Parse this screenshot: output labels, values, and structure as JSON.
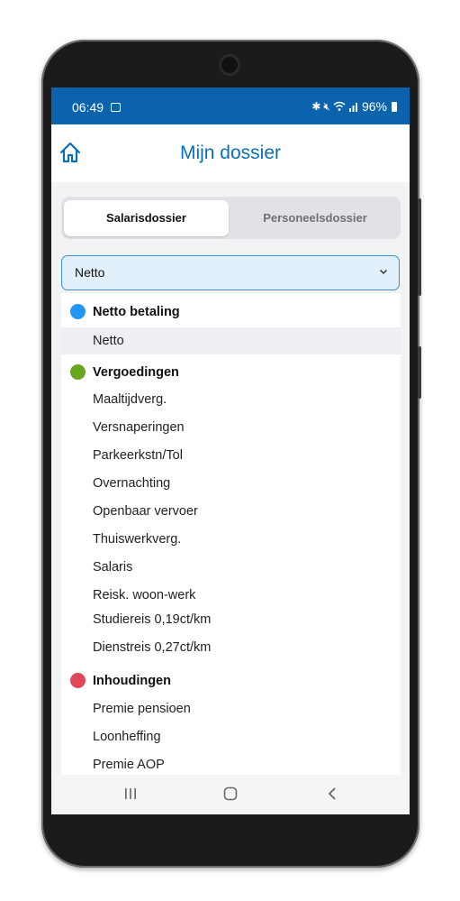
{
  "status_bar": {
    "time": "06:49",
    "status_icons": [
      "image-icon",
      "bluetooth-icon",
      "mute-icon",
      "wifi-icon",
      "signal-icon"
    ],
    "battery": "96%"
  },
  "app_bar": {
    "title": "Mijn dossier",
    "home_icon": "home-icon"
  },
  "tabs": [
    {
      "label": "Salarisdossier",
      "active": true
    },
    {
      "label": "Personeelsdossier",
      "active": false
    }
  ],
  "select": {
    "value": "Netto"
  },
  "dropdown": {
    "groups": [
      {
        "label": "Netto betaling",
        "color": "#2196f3",
        "items": [
          "Netto"
        ]
      },
      {
        "label": "Vergoedingen",
        "color": "#6aa51e",
        "items": [
          "Maaltijdverg.",
          "Versnaperingen",
          "Parkeerkstn/Tol",
          "Overnachting",
          "Openbaar vervoer",
          "Thuiswerkverg.",
          "Salaris",
          "Reisk. woon-werk",
          "Studiereis 0,19ct/km",
          "Dienstreis 0,27ct/km"
        ]
      },
      {
        "label": "Inhoudingen",
        "color": "#e04858",
        "items": [
          "Premie pensioen",
          "Loonheffing",
          "Premie AOP"
        ]
      }
    ],
    "selected_item": "Netto"
  },
  "nav_bar": {
    "icons": [
      "recent-apps-icon",
      "home-button-icon",
      "back-icon"
    ]
  },
  "colors": {
    "status_bar": "#0b63ad",
    "accent": "#0a6fb8",
    "select_bg": "#e1f0fb"
  }
}
